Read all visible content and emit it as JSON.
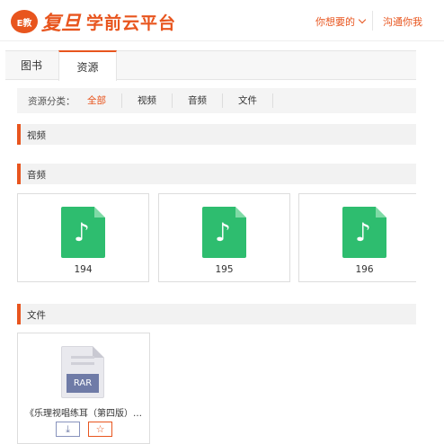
{
  "header": {
    "logo_badge": "E教",
    "logo_script": "复旦",
    "title": "学前云平台",
    "nav_want": "你想要的",
    "nav_talk": "沟通你我"
  },
  "tabs": [
    "图书",
    "资源"
  ],
  "filter": {
    "label": "资源分类：",
    "items": [
      "全部",
      "视频",
      "音频",
      "文件"
    ]
  },
  "sections": {
    "video": "视频",
    "audio": "音频",
    "file": "文件"
  },
  "audio_items": [
    {
      "icon": "music-note-icon",
      "label": "194"
    },
    {
      "icon": "music-note-icon",
      "label": "195"
    },
    {
      "icon": "music-note-icon",
      "label": "196"
    }
  ],
  "files": [
    {
      "badge": "RAR",
      "name": "《乐理视唱练耳（第四版）…",
      "download_icon": "⤓",
      "favorite_icon": "☆"
    }
  ],
  "colors": {
    "accent": "#e8551e",
    "audio_icon": "#2ebd6f",
    "rar_badge": "#6f7ba7"
  }
}
